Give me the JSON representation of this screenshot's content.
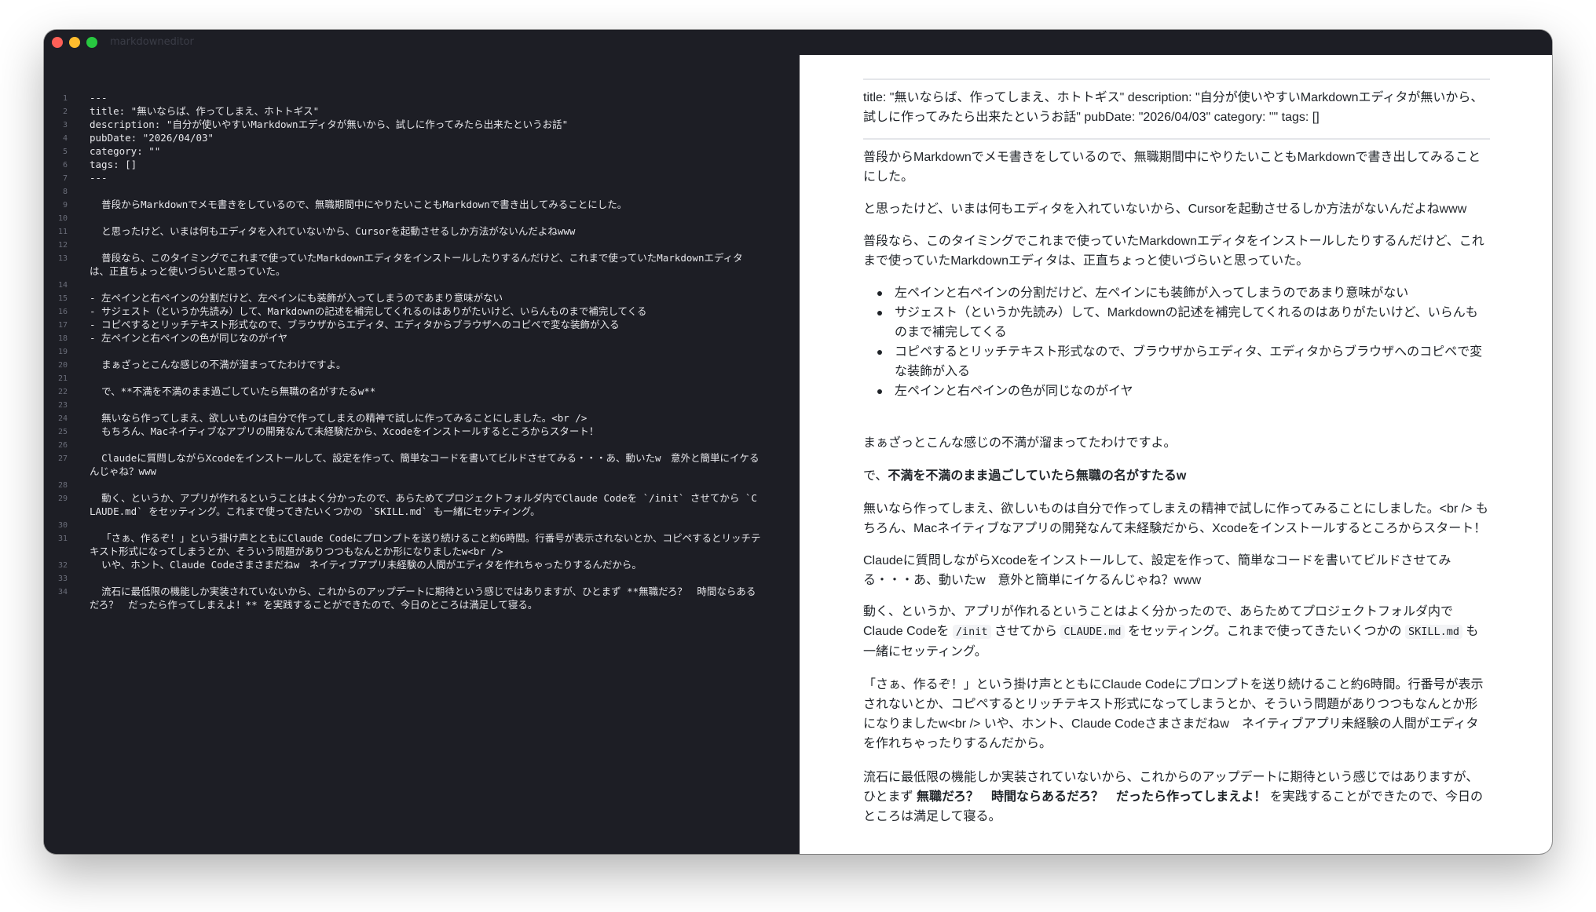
{
  "window": {
    "title": "markdowneditor"
  },
  "editor": {
    "lines": [
      {
        "n": "1",
        "text": "---"
      },
      {
        "n": "2",
        "text": "title: \"無いならば、作ってしまえ、ホトトギス\""
      },
      {
        "n": "3",
        "text": "description: \"自分が使いやすいMarkdownエディタが無いから、試しに作ってみたら出来たというお話\""
      },
      {
        "n": "4",
        "text": "pubDate: \"2026/04/03\""
      },
      {
        "n": "5",
        "text": "category: \"\""
      },
      {
        "n": "6",
        "text": "tags: []"
      },
      {
        "n": "7",
        "text": "---"
      },
      {
        "n": "8",
        "text": ""
      },
      {
        "n": "9",
        "text": "  普段からMarkdownでメモ書きをしているので、無職期間中にやりたいこともMarkdownで書き出してみることにした。"
      },
      {
        "n": "10",
        "text": ""
      },
      {
        "n": "11",
        "text": "  と思ったけど、いまは何もエディタを入れていないから、Cursorを起動させるしか方法がないんだよねwww"
      },
      {
        "n": "12",
        "text": ""
      },
      {
        "n": "13",
        "text": "  普段なら、このタイミングでこれまで使っていたMarkdownエディタをインストールしたりするんだけど、これまで使っていたMarkdownエディタは、正直ちょっと使いづらいと思っていた。"
      },
      {
        "n": "14",
        "text": ""
      },
      {
        "n": "15",
        "text": "- 左ペインと右ペインの分割だけど、左ペインにも装飾が入ってしまうのであまり意味がない"
      },
      {
        "n": "16",
        "text": "- サジェスト（というか先読み）して、Markdownの記述を補完してくれるのはありがたいけど、いらんものまで補完してくる"
      },
      {
        "n": "17",
        "text": "- コピペするとリッチテキスト形式なので、ブラウザからエディタ、エディタからブラウザへのコピペで変な装飾が入る"
      },
      {
        "n": "18",
        "text": "- 左ペインと右ペインの色が同じなのがイヤ"
      },
      {
        "n": "19",
        "text": ""
      },
      {
        "n": "20",
        "text": "  まぁざっとこんな感じの不満が溜まってたわけですよ。"
      },
      {
        "n": "21",
        "text": ""
      },
      {
        "n": "22",
        "text": "  で、**不満を不満のまま過ごしていたら無職の名がすたるw**"
      },
      {
        "n": "23",
        "text": ""
      },
      {
        "n": "24",
        "text": "  無いなら作ってしまえ、欲しいものは自分で作ってしまえの精神で試しに作ってみることにしました。<br />"
      },
      {
        "n": "25",
        "text": "  もちろん、Macネイティブなアプリの開発なんて未経験だから、Xcodeをインストールするところからスタート！"
      },
      {
        "n": "26",
        "text": ""
      },
      {
        "n": "27",
        "text": "  Claudeに質問しながらXcodeをインストールして、設定を作って、簡単なコードを書いてビルドさせてみる・・・あ、動いたw　意外と簡単にイケるんじゃね？www"
      },
      {
        "n": "28",
        "text": ""
      },
      {
        "n": "29",
        "text": "  動く、というか、アプリが作れるということはよく分かったので、あらためてプロジェクトフォルダ内でClaude Codeを `/init` させてから `CLAUDE.md` をセッティング。これまで使ってきたいくつかの `SKILL.md` も一緒にセッティング。"
      },
      {
        "n": "30",
        "text": ""
      },
      {
        "n": "31",
        "text": "  「さぁ、作るぞ！」という掛け声とともにClaude Codeにプロンプトを送り続けること約6時間。行番号が表示されないとか、コピペするとリッチテキスト形式になってしまうとか、そういう問題がありつつもなんとか形になりましたw<br />"
      },
      {
        "n": "32",
        "text": "  いや、ホント、Claude Codeさまさまだねw　ネイティブアプリ未経験の人間がエディタを作れちゃったりするんだから。"
      },
      {
        "n": "33",
        "text": ""
      },
      {
        "n": "34",
        "text": "  流石に最低限の機能しか実装されていないから、これからのアップデートに期待という感じではありますが、ひとまず **無職だろ？　時間ならあるだろ？　だったら作ってしまえよ！** を実践することができたので、今日のところは満足して寝る。"
      }
    ]
  },
  "preview": {
    "frontmatter": "title: \"無いならば、作ってしまえ、ホトトギス\" description: \"自分が使いやすいMarkdownエディタが無いから、試しに作ってみたら出来たというお話\" pubDate: \"2026/04/03\" category: \"\" tags: []",
    "p1": "普段からMarkdownでメモ書きをしているので、無職期間中にやりたいこともMarkdownで書き出してみることにした。",
    "p2": "と思ったけど、いまは何もエディタを入れていないから、Cursorを起動させるしか方法がないんだよねwww",
    "p3": "普段なら、このタイミングでこれまで使っていたMarkdownエディタをインストールしたりするんだけど、これまで使っていたMarkdownエディタは、正直ちょっと使いづらいと思っていた。",
    "list": [
      "左ペインと右ペインの分割だけど、左ペインにも装飾が入ってしまうのであまり意味がない",
      "サジェスト（というか先読み）して、Markdownの記述を補完してくれるのはありがたいけど、いらんものまで補完してくる",
      "コピペするとリッチテキスト形式なので、ブラウザからエディタ、エディタからブラウザへのコピペで変な装飾が入る",
      "左ペインと右ペインの色が同じなのがイヤ"
    ],
    "p4": "まぁざっとこんな感じの不満が溜まってたわけですよ。",
    "p5_prefix": "で、",
    "p5_bold": "不満を不満のまま過ごしていたら無職の名がすたるw",
    "p6": "無いなら作ってしまえ、欲しいものは自分で作ってしまえの精神で試しに作ってみることにしました。<br /> もちろん、Macネイティブなアプリの開発なんて未経験だから、Xcodeをインストールするところからスタート！",
    "p7": "Claudeに質問しながらXcodeをインストールして、設定を作って、簡単なコードを書いてビルドさせてみる・・・あ、動いたw　意外と簡単にイケるんじゃね？www",
    "p8_a": "動く、というか、アプリが作れるということはよく分かったので、あらためてプロジェクトフォルダ内でClaude Codeを ",
    "p8_code1": "/init",
    "p8_b": " させてから ",
    "p8_code2": "CLAUDE.md",
    "p8_c": " をセッティング。これまで使ってきたいくつかの ",
    "p8_code3": "SKILL.md",
    "p8_d": " も一緒にセッティング。",
    "p9": "「さぁ、作るぞ！」という掛け声とともにClaude Codeにプロンプトを送り続けること約6時間。行番号が表示されないとか、コピペするとリッチテキスト形式になってしまうとか、そういう問題がありつつもなんとか形になりましたw<br /> いや、ホント、Claude Codeさまさまだねw　ネイティブアプリ未経験の人間がエディタを作れちゃったりするんだから。",
    "p10_prefix": "流石に最低限の機能しか実装されていないから、これからのアップデートに期待という感じではありますが、ひとまず ",
    "p10_bold": "無職だろ？　時間ならあるだろ？　だったら作ってしまえよ！",
    "p10_suffix": " を実践することができたので、今日のところは満足して寝る。"
  }
}
